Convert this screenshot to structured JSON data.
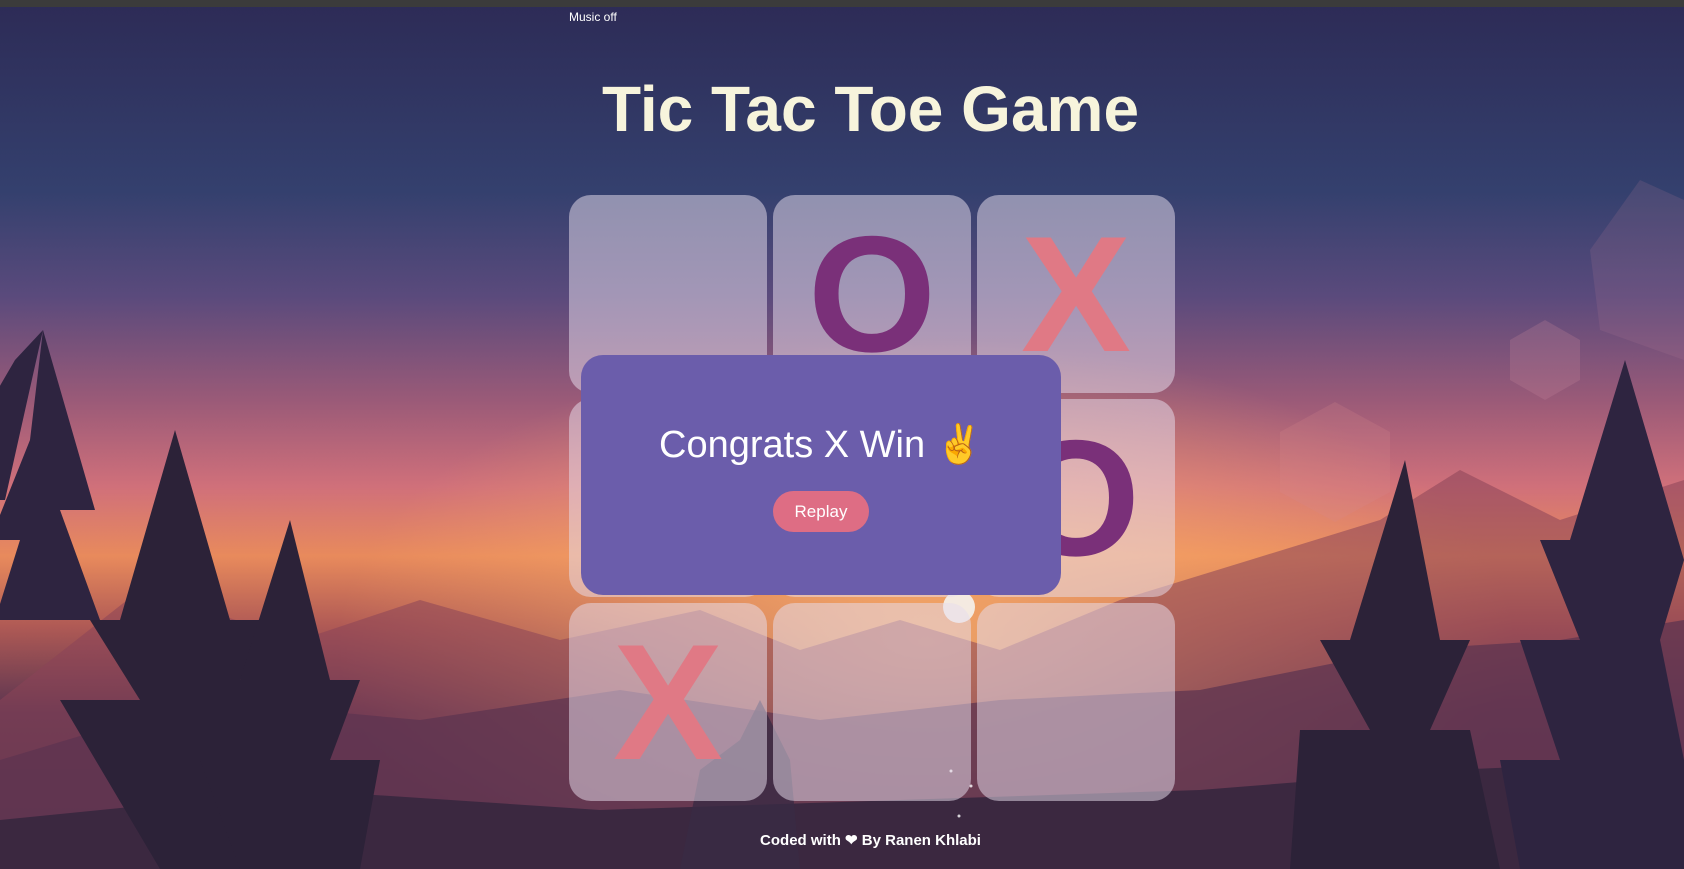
{
  "app": {
    "music_toggle_label": "Music off",
    "title": "Tic Tac Toe Game"
  },
  "board": {
    "cells": [
      "",
      "O",
      "X",
      "",
      "",
      "O",
      "X",
      "",
      ""
    ]
  },
  "result": {
    "message": "Congrats X Win ✌️",
    "replay_label": "Replay"
  },
  "footer": {
    "prefix": "Coded with",
    "heart": "❤",
    "suffix": "By Ranen Khlabi"
  },
  "colors": {
    "x_mark": "#e07985",
    "o_mark": "#7a3079",
    "modal_bg": "#6b5dab",
    "replay_bg": "#de6d84",
    "title": "#f7f4dc"
  }
}
